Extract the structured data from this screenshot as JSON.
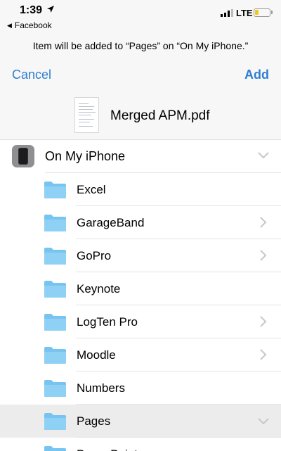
{
  "status_bar": {
    "time": "1:39",
    "back_app": "Facebook",
    "network": "LTE",
    "battery_color": "#f5c518"
  },
  "header": {
    "subtitle": "Item will be added to “Pages” on “On My iPhone.”",
    "cancel_label": "Cancel",
    "add_label": "Add",
    "accent_color": "#2f7fd0"
  },
  "file": {
    "name": "Merged APM.pdf",
    "icon": "pdf-thumbnail"
  },
  "locations": {
    "root": {
      "label": "On My iPhone",
      "icon": "iphone-icon",
      "expanded": true
    },
    "folders": [
      {
        "label": "Excel",
        "has_children": false,
        "selected": false
      },
      {
        "label": "GarageBand",
        "has_children": true,
        "selected": false
      },
      {
        "label": "GoPro",
        "has_children": true,
        "selected": false
      },
      {
        "label": "Keynote",
        "has_children": false,
        "selected": false
      },
      {
        "label": "LogTen Pro",
        "has_children": true,
        "selected": false
      },
      {
        "label": "Moodle",
        "has_children": true,
        "selected": false
      },
      {
        "label": "Numbers",
        "has_children": false,
        "selected": false
      },
      {
        "label": "Pages",
        "has_children": true,
        "selected": true,
        "expanded": true
      },
      {
        "label": "PowerPoint",
        "has_children": false,
        "selected": false
      }
    ]
  }
}
